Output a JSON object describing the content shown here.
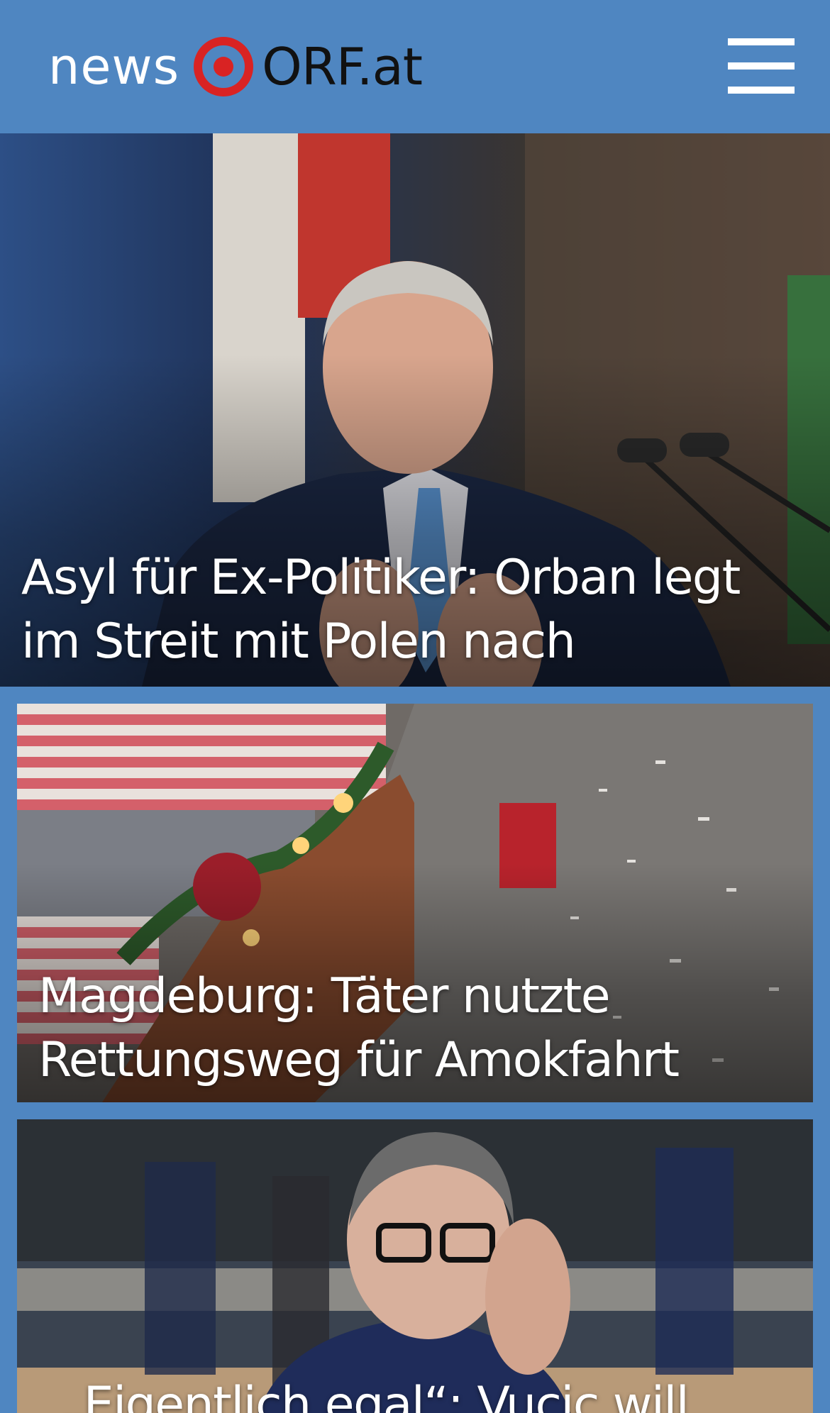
{
  "header": {
    "logo_news": "news",
    "logo_orf": "ORF.at",
    "menu_icon": "hamburger-menu-icon"
  },
  "colors": {
    "header_bg": "#4f86c1",
    "logo_ring": "#d92323",
    "logo_text": "#111111"
  },
  "articles": [
    {
      "headline": "Asyl für Ex-Politiker: Orban legt im Streit mit Polen nach"
    },
    {
      "headline": "Magdeburg: Täter nutzte Rettungsweg für Amokfahrt"
    },
    {
      "headline": "„Eigentlich egal“: Vucic will"
    }
  ]
}
